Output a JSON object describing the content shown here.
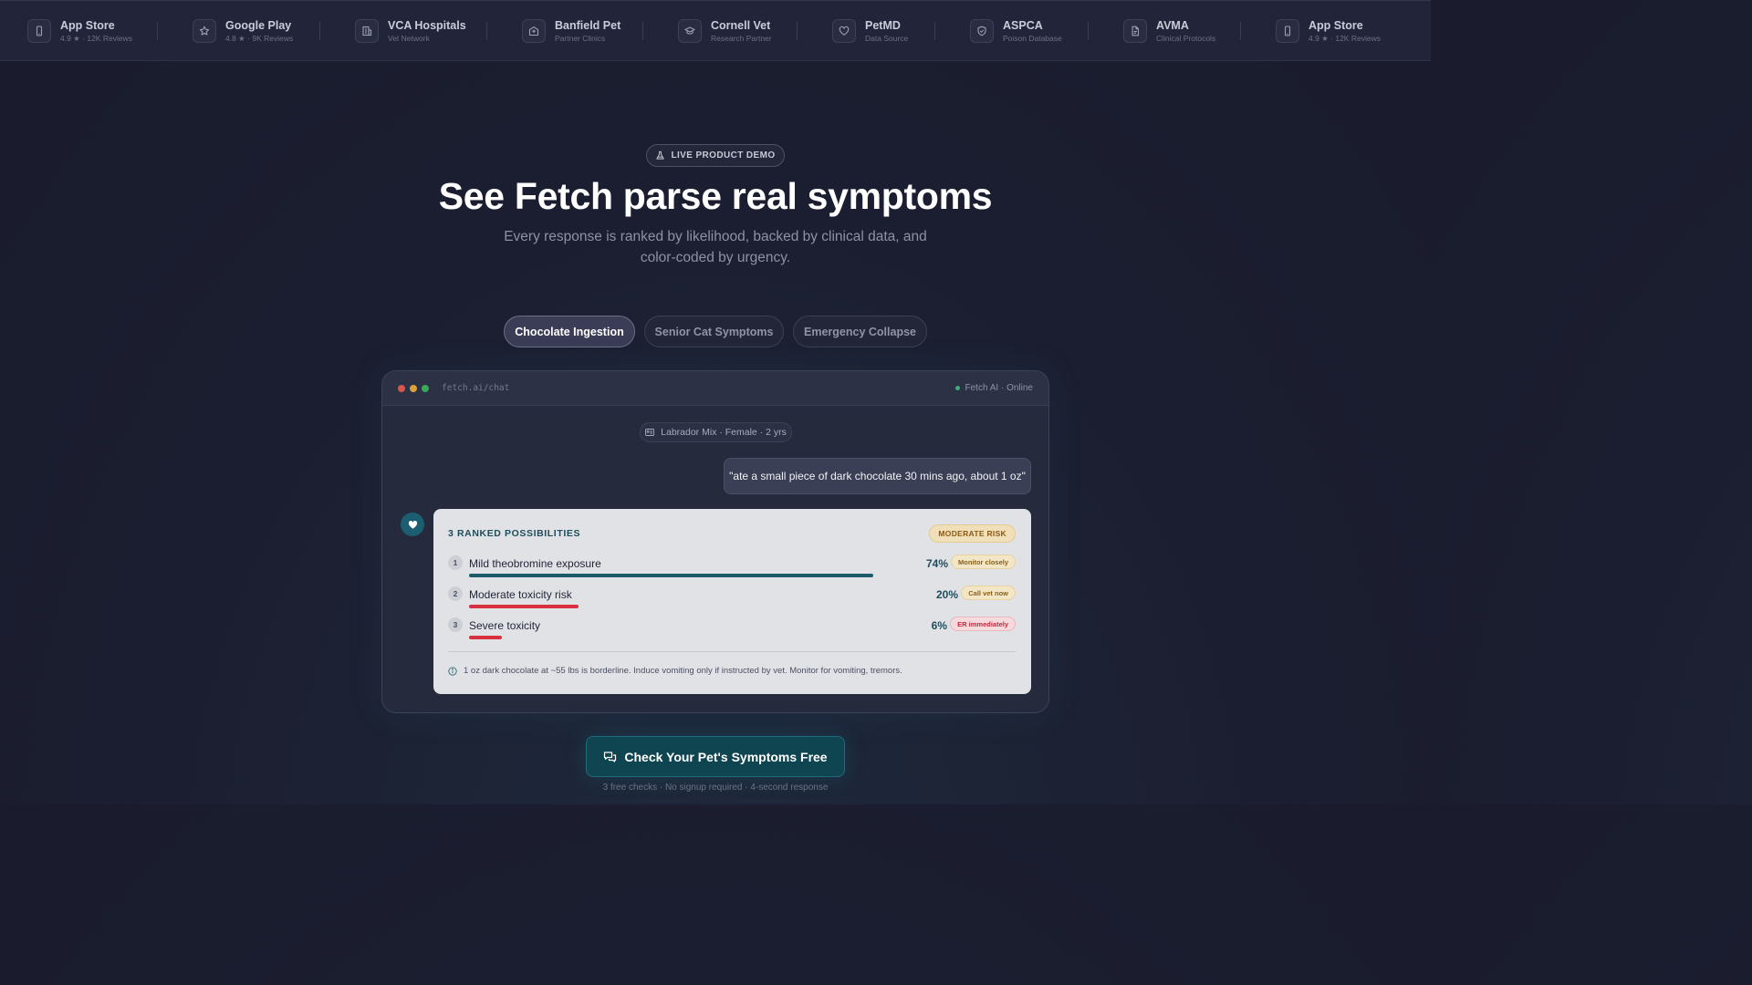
{
  "partners": [
    {
      "icon": "phone-icon",
      "name": "App Store",
      "sub": "4.9 ★ · 12K Reviews"
    },
    {
      "icon": "star-icon",
      "name": "Google Play",
      "sub": "4.8 ★ · 9K Reviews"
    },
    {
      "icon": "building-icon",
      "name": "VCA Hospitals",
      "sub": "Vet Network"
    },
    {
      "icon": "clinic-icon",
      "name": "Banfield Pet",
      "sub": "Partner Clinics"
    },
    {
      "icon": "graduation-cap-icon",
      "name": "Cornell Vet",
      "sub": "Research Partner"
    },
    {
      "icon": "heart-icon",
      "name": "PetMD",
      "sub": "Data Source"
    },
    {
      "icon": "shield-icon",
      "name": "ASPCA",
      "sub": "Poison Database"
    },
    {
      "icon": "document-icon",
      "name": "AVMA",
      "sub": "Clinical Protocols"
    },
    {
      "icon": "phone-icon",
      "name": "App Store",
      "sub": "4.9 ★ · 12K Reviews"
    }
  ],
  "hero": {
    "badge": "LIVE PRODUCT DEMO",
    "title": "See Fetch parse real symptoms",
    "subtitle": "Every response is ranked by likelihood, backed by clinical data, and color-coded by urgency."
  },
  "tabs": [
    {
      "label": "Chocolate Ingestion",
      "active": true
    },
    {
      "label": "Senior Cat Symptoms",
      "active": false
    },
    {
      "label": "Emergency Collapse",
      "active": false
    }
  ],
  "chat": {
    "url": "fetch.ai/chat",
    "status": "Fetch AI · Online",
    "pet_profile": "Labrador Mix · Female · 2 yrs",
    "user_message": "\"ate a small piece of dark chocolate 30 mins ago, about 1 oz\"",
    "result": {
      "title": "3 RANKED POSSIBILITIES",
      "risk_badge": "MODERATE RISK",
      "items": [
        {
          "rank": "1",
          "label": "Mild theobromine exposure",
          "percent_text": "74%",
          "value": 74,
          "action": "Monitor closely",
          "bar_color": "#1a5a6b",
          "urgency": "warn"
        },
        {
          "rank": "2",
          "label": "Moderate toxicity risk",
          "percent_text": "20%",
          "value": 20,
          "action": "Call vet now",
          "bar_color": "#d93040",
          "urgency": "warn"
        },
        {
          "rank": "3",
          "label": "Severe toxicity",
          "percent_text": "6%",
          "value": 6,
          "action": "ER immediately",
          "bar_color": "#d93040",
          "urgency": "danger"
        }
      ],
      "note": "1 oz dark chocolate at ~55 lbs is borderline. Induce vomiting only if instructed by vet. Monitor for vomiting, tremors."
    }
  },
  "cta": {
    "label": "Check Your Pet's Symptoms Free",
    "sub": "3 free checks · No signup required · 4-second response"
  },
  "colors": {
    "accent_teal": "#0f4451",
    "online": "#3ab07a",
    "window_dots": [
      "#d4574e",
      "#d9a23a",
      "#3aa75a"
    ]
  }
}
